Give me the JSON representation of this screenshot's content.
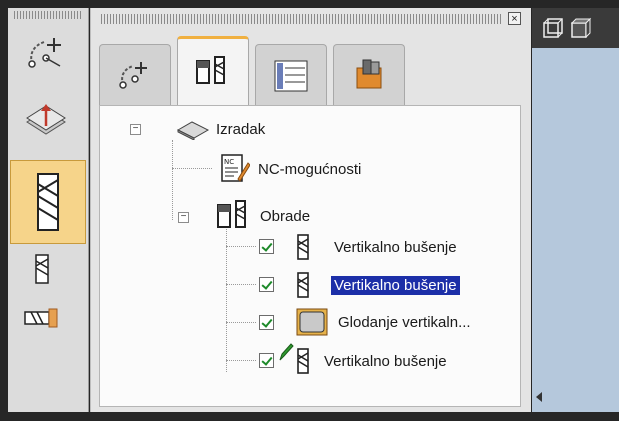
{
  "tabs": [
    {
      "icon": "path-edit-icon",
      "active": false
    },
    {
      "icon": "operations-tree-icon",
      "active": true
    },
    {
      "icon": "program-table-icon",
      "active": false
    },
    {
      "icon": "tool-block-icon",
      "active": false
    }
  ],
  "tree": {
    "root": {
      "label": "Izradak",
      "icon": "workpiece-icon"
    },
    "nc": {
      "label": "NC-mogućnosti",
      "icon": "nc-document-icon"
    },
    "obrade": {
      "label": "Obrade",
      "icon": "operations-icon"
    },
    "operations": [
      {
        "label": "Vertikalno bušenje",
        "checked": true,
        "selected": false,
        "icon": "drill-icon"
      },
      {
        "label": "Vertikalno bušenje",
        "checked": true,
        "selected": true,
        "icon": "drill-icon"
      },
      {
        "label": "Glodanje vertikaln...",
        "checked": true,
        "selected": false,
        "icon": "milling-pocket-icon"
      },
      {
        "label": "Vertikalno bušenje",
        "checked": true,
        "selected": false,
        "icon": "drill-icon",
        "edit_marker": true
      }
    ]
  },
  "left_toolbar": [
    {
      "icon": "path-edit-icon"
    },
    {
      "icon": "workpiece-layer-icon"
    },
    {
      "icon": "drill-icon",
      "active": true
    },
    {
      "icon": "small-drill-icon"
    },
    {
      "icon": "horizontal-drill-icon"
    }
  ],
  "colors": {
    "selection": "#1c2fa8",
    "active_tab": "#f0b040",
    "active_tool": "#f6d48a"
  }
}
